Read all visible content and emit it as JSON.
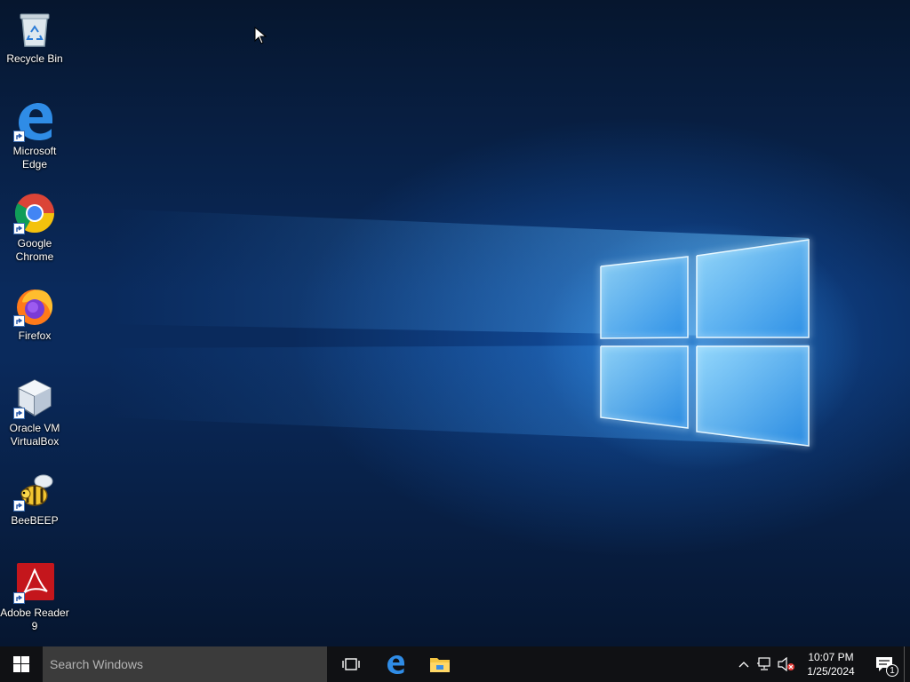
{
  "desktop": {
    "icons": [
      {
        "label": "Recycle Bin",
        "icon": "recycle-bin-icon"
      },
      {
        "label": "Microsoft Edge",
        "icon": "edge-icon"
      },
      {
        "label": "Google Chrome",
        "icon": "chrome-icon"
      },
      {
        "label": "Firefox",
        "icon": "firefox-icon"
      },
      {
        "label": "Oracle VM VirtualBox",
        "icon": "virtualbox-icon"
      },
      {
        "label": "BeeBEEP",
        "icon": "beebeep-icon"
      },
      {
        "label": "Adobe Reader 9",
        "icon": "adobe-reader-icon"
      }
    ]
  },
  "taskbar": {
    "search_placeholder": "Search Windows",
    "pinned": [
      {
        "name": "task-view",
        "icon": "task-view-icon"
      },
      {
        "name": "edge",
        "icon": "edge-icon"
      },
      {
        "name": "file-explorer",
        "icon": "file-explorer-icon"
      }
    ],
    "tray": {
      "icons": [
        "chevron-up-icon",
        "network-icon",
        "volume-muted-icon"
      ],
      "time": "10:07 PM",
      "date": "1/25/2024",
      "notification_count": "1"
    }
  },
  "colors": {
    "taskbar": "#101114",
    "search_box": "#3b3b3b",
    "accent": "#1e88e5",
    "wallpaper_glow": "#3ca8ff"
  }
}
